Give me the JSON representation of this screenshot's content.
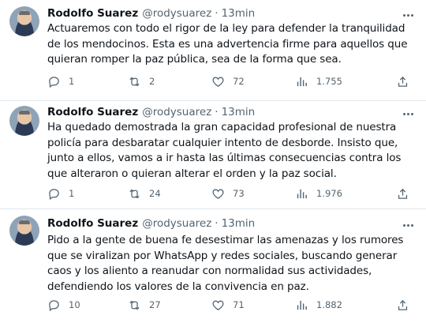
{
  "tweets": [
    {
      "name": "Rodolfo Suarez",
      "handle": "@rodysuarez",
      "separator": "·",
      "time": "13min",
      "text": "Actuaremos con todo el rigor de la ley para defender la tranquilidad de los mendocinos. Esta es una advertencia firme para aquellos que quieran romper la paz pública, sea de la forma que sea.",
      "replies": "1",
      "retweets": "2",
      "likes": "72",
      "views": "1.755"
    },
    {
      "name": "Rodolfo Suarez",
      "handle": "@rodysuarez",
      "separator": "·",
      "time": "13min",
      "text": "Ha quedado demostrada la gran capacidad profesional de nuestra policía para  desbaratar cualquier intento de desborde. Insisto que, junto a ellos, vamos a ir hasta las últimas consecuencias contra los que alteraron o quieran alterar el orden y la paz social.",
      "replies": "1",
      "retweets": "24",
      "likes": "73",
      "views": "1.976"
    },
    {
      "name": "Rodolfo Suarez",
      "handle": "@rodysuarez",
      "separator": "·",
      "time": "13min",
      "text": "Pido a la gente de buena fe desestimar las amenazas y los rumores que se viralizan por WhatsApp y redes sociales, buscando generar caos y los aliento a reanudar con normalidad sus actividades, defendiendo los valores de la convivencia en paz.",
      "replies": "10",
      "retweets": "27",
      "likes": "71",
      "views": "1.882"
    }
  ],
  "icons": {
    "reply": "reply-icon",
    "retweet": "retweet-icon",
    "like": "heart-icon",
    "views": "views-icon",
    "share": "share-icon",
    "more": "more-icon"
  },
  "colors": {
    "text": "#0f1419",
    "secondary": "#536471",
    "divider": "#e1e8ed"
  }
}
